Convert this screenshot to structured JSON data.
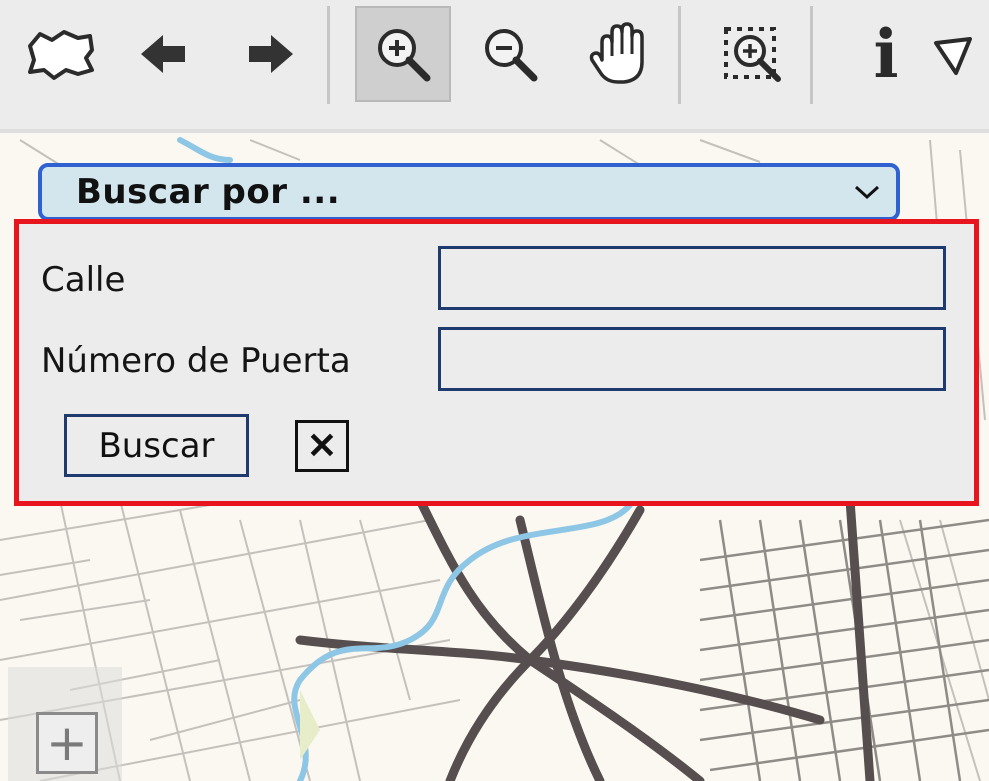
{
  "toolbar": {
    "tools": [
      {
        "icon": "map-extent-icon"
      },
      {
        "icon": "back-arrow-icon"
      },
      {
        "icon": "forward-arrow-icon"
      },
      {
        "icon": "zoom-in-icon",
        "active": true
      },
      {
        "icon": "zoom-out-icon"
      },
      {
        "icon": "pan-hand-icon"
      },
      {
        "icon": "zoom-to-selection-icon"
      },
      {
        "icon": "info-icon",
        "glyph": "i"
      },
      {
        "icon": "select-arrow-icon"
      }
    ]
  },
  "search": {
    "selector_label": "Buscar por ...",
    "street_label": "Calle",
    "street_value": "",
    "door_number_label": "Número de Puerta",
    "door_number_value": "",
    "submit_label": "Buscar",
    "close_glyph": "✕"
  },
  "map": {
    "zoom_in_glyph": "+"
  },
  "colors": {
    "panel_highlight_border": "#e8141e",
    "selector_border": "#2f62d0",
    "selector_background": "#d3e6ee",
    "input_border": "#1e3a6e",
    "river": "#8ec6e6",
    "major_roads": "#555050"
  }
}
